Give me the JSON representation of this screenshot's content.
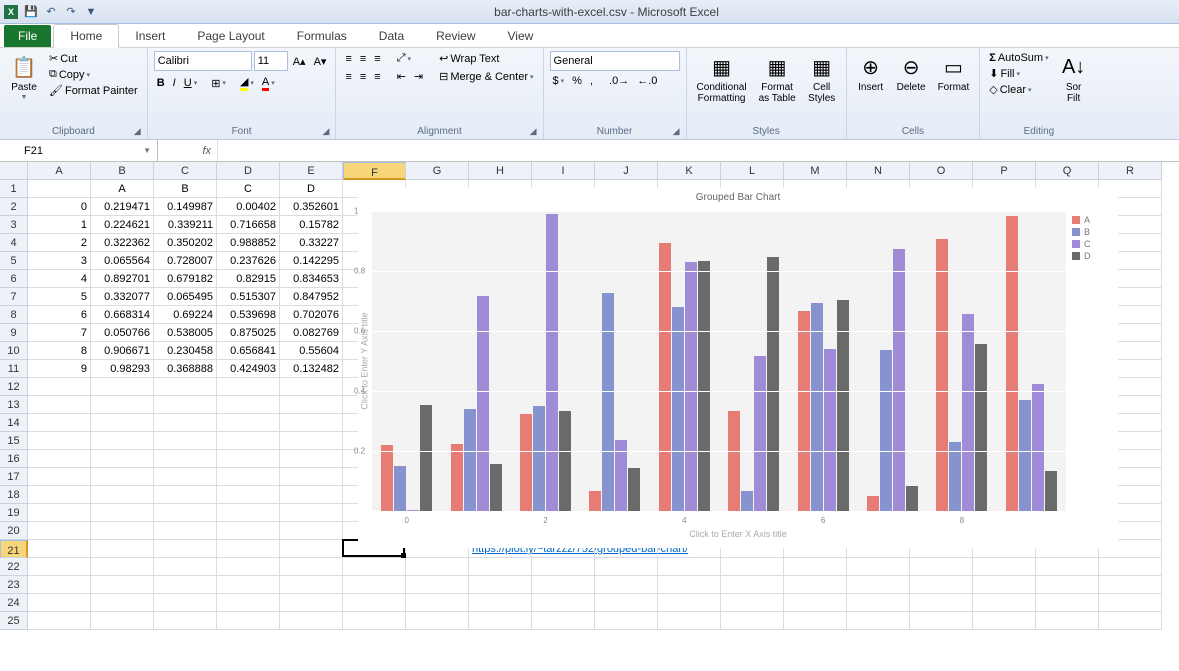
{
  "chart_data": {
    "type": "bar",
    "title": "Grouped Bar Chart",
    "xlabel": "Click to Enter X Axis title",
    "ylabel": "Click to Enter Y Axis title",
    "categories": [
      0,
      1,
      2,
      3,
      4,
      5,
      6,
      7,
      8,
      9
    ],
    "ylim": [
      0,
      1.0
    ],
    "yticks": [
      0.2,
      0.4,
      0.6,
      0.8,
      1.0
    ],
    "series": [
      {
        "name": "A",
        "color": "#e77c74",
        "values": [
          0.219471,
          0.224621,
          0.322362,
          0.065564,
          0.892701,
          0.332077,
          0.668314,
          0.050766,
          0.906671,
          0.98293
        ]
      },
      {
        "name": "B",
        "color": "#8693cf",
        "values": [
          0.149987,
          0.339211,
          0.350202,
          0.728007,
          0.679182,
          0.065495,
          0.69224,
          0.538005,
          0.230458,
          0.368888
        ]
      },
      {
        "name": "C",
        "color": "#9f8bd6",
        "values": [
          0.00402,
          0.716658,
          0.988852,
          0.237626,
          0.82915,
          0.515307,
          0.539698,
          0.875025,
          0.656841,
          0.424903
        ]
      },
      {
        "name": "D",
        "color": "#6a6a6a",
        "values": [
          0.352601,
          0.15782,
          0.33227,
          0.142295,
          0.834653,
          0.847952,
          0.702076,
          0.082769,
          0.55604,
          0.132482
        ]
      }
    ]
  },
  "title": "bar-charts-with-excel.csv - Microsoft Excel",
  "tabs": {
    "file": "File",
    "home": "Home",
    "insert": "Insert",
    "pagelayout": "Page Layout",
    "formulas": "Formulas",
    "data": "Data",
    "review": "Review",
    "view": "View"
  },
  "ribbon": {
    "clipboard": {
      "label": "Clipboard",
      "paste": "Paste",
      "cut": "Cut",
      "copy": "Copy",
      "fmtpainter": "Format Painter"
    },
    "font": {
      "label": "Font",
      "name": "Calibri",
      "size": "11"
    },
    "alignment": {
      "label": "Alignment",
      "wrap": "Wrap Text",
      "merge": "Merge & Center"
    },
    "number": {
      "label": "Number",
      "format": "General"
    },
    "styles": {
      "label": "Styles",
      "cond": "Conditional\nFormatting",
      "table": "Format\nas Table",
      "cell": "Cell\nStyles"
    },
    "cells": {
      "label": "Cells",
      "insert": "Insert",
      "delete": "Delete",
      "format": "Format"
    },
    "editing": {
      "label": "Editing",
      "autosum": "AutoSum",
      "fill": "Fill",
      "clear": "Clear",
      "sort": "Sor\nFilt"
    }
  },
  "namebox": "F21",
  "columns": [
    "A",
    "B",
    "C",
    "D",
    "E",
    "F",
    "G",
    "H",
    "I",
    "J",
    "K",
    "L",
    "M",
    "N",
    "O",
    "P",
    "Q",
    "R"
  ],
  "active_col": "F",
  "active_row": 21,
  "rows_total": 25,
  "table": {
    "headers": [
      "",
      "A",
      "B",
      "C",
      "D"
    ],
    "rows": [
      [
        "0",
        "0.219471",
        "0.149987",
        "0.00402",
        "0.352601"
      ],
      [
        "1",
        "0.224621",
        "0.339211",
        "0.716658",
        "0.15782"
      ],
      [
        "2",
        "0.322362",
        "0.350202",
        "0.988852",
        "0.33227"
      ],
      [
        "3",
        "0.065564",
        "0.728007",
        "0.237626",
        "0.142295"
      ],
      [
        "4",
        "0.892701",
        "0.679182",
        "0.82915",
        "0.834653"
      ],
      [
        "5",
        "0.332077",
        "0.065495",
        "0.515307",
        "0.847952"
      ],
      [
        "6",
        "0.668314",
        "0.69224",
        "0.539698",
        "0.702076"
      ],
      [
        "7",
        "0.050766",
        "0.538005",
        "0.875025",
        "0.082769"
      ],
      [
        "8",
        "0.906671",
        "0.230458",
        "0.656841",
        "0.55604"
      ],
      [
        "9",
        "0.98293",
        "0.368888",
        "0.424903",
        "0.132482"
      ]
    ]
  },
  "link": "https://plot.ly/~tarzzz/752/grouped-bar-chart/"
}
